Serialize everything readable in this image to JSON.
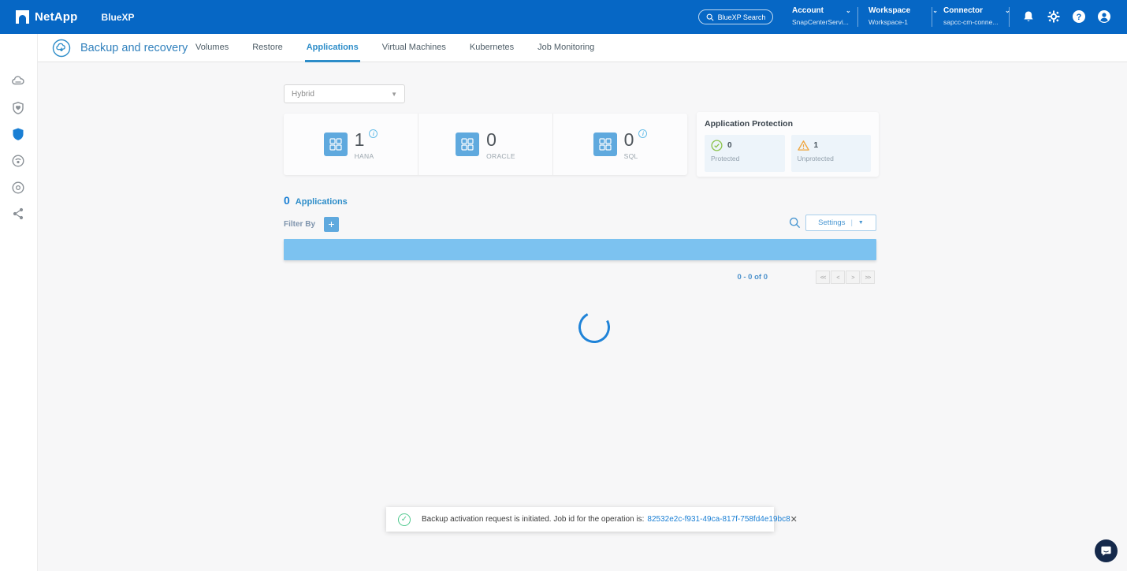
{
  "topbar": {
    "brand": "NetApp",
    "product": "BlueXP",
    "search_label": "BlueXP Search",
    "menus": [
      {
        "label": "Account",
        "value": "SnapCenterServi..."
      },
      {
        "label": "Workspace",
        "value": "Workspace-1"
      },
      {
        "label": "Connector",
        "value": "sapcc-cm-conne..."
      }
    ]
  },
  "header": {
    "title": "Backup and recovery",
    "tabs": [
      {
        "label": "Volumes"
      },
      {
        "label": "Restore"
      },
      {
        "label": "Applications"
      },
      {
        "label": "Virtual Machines"
      },
      {
        "label": "Kubernetes"
      },
      {
        "label": "Job Monitoring"
      }
    ],
    "active_tab": "Applications"
  },
  "filters": {
    "environment": "Hybrid"
  },
  "stats": {
    "items": [
      {
        "count": "1",
        "label": "HANA"
      },
      {
        "count": "0",
        "label": "ORACLE"
      },
      {
        "count": "0",
        "label": "SQL"
      }
    ]
  },
  "protection": {
    "title": "Application Protection",
    "protected": {
      "count": "0",
      "label": "Protected"
    },
    "unprotected": {
      "count": "1",
      "label": "Unprotected"
    }
  },
  "list": {
    "count": "0",
    "count_label": "Applications",
    "filter_by_label": "Filter By",
    "settings_label": "Settings",
    "pagination": {
      "range": "0 - 0 of 0",
      "first": "<<",
      "prev": "<",
      "next": ">",
      "last": ">>"
    }
  },
  "toast": {
    "message": "Backup activation request is initiated. Job id for the operation is:",
    "job_id": "82532e2c-f931-49ca-817f-758fd4e19bc8",
    "close": "✕"
  },
  "colors": {
    "topbar": "#0667c5",
    "accent_blue": "#1a7fd4",
    "tab_active": "#2d8dc9",
    "table_header_bar": "#7cc2f0",
    "app_icon_square": "#5fa9de",
    "toast_edge": "#2ec5d3",
    "success_green": "#4fc98e",
    "warning_orange": "#f0a43a"
  }
}
